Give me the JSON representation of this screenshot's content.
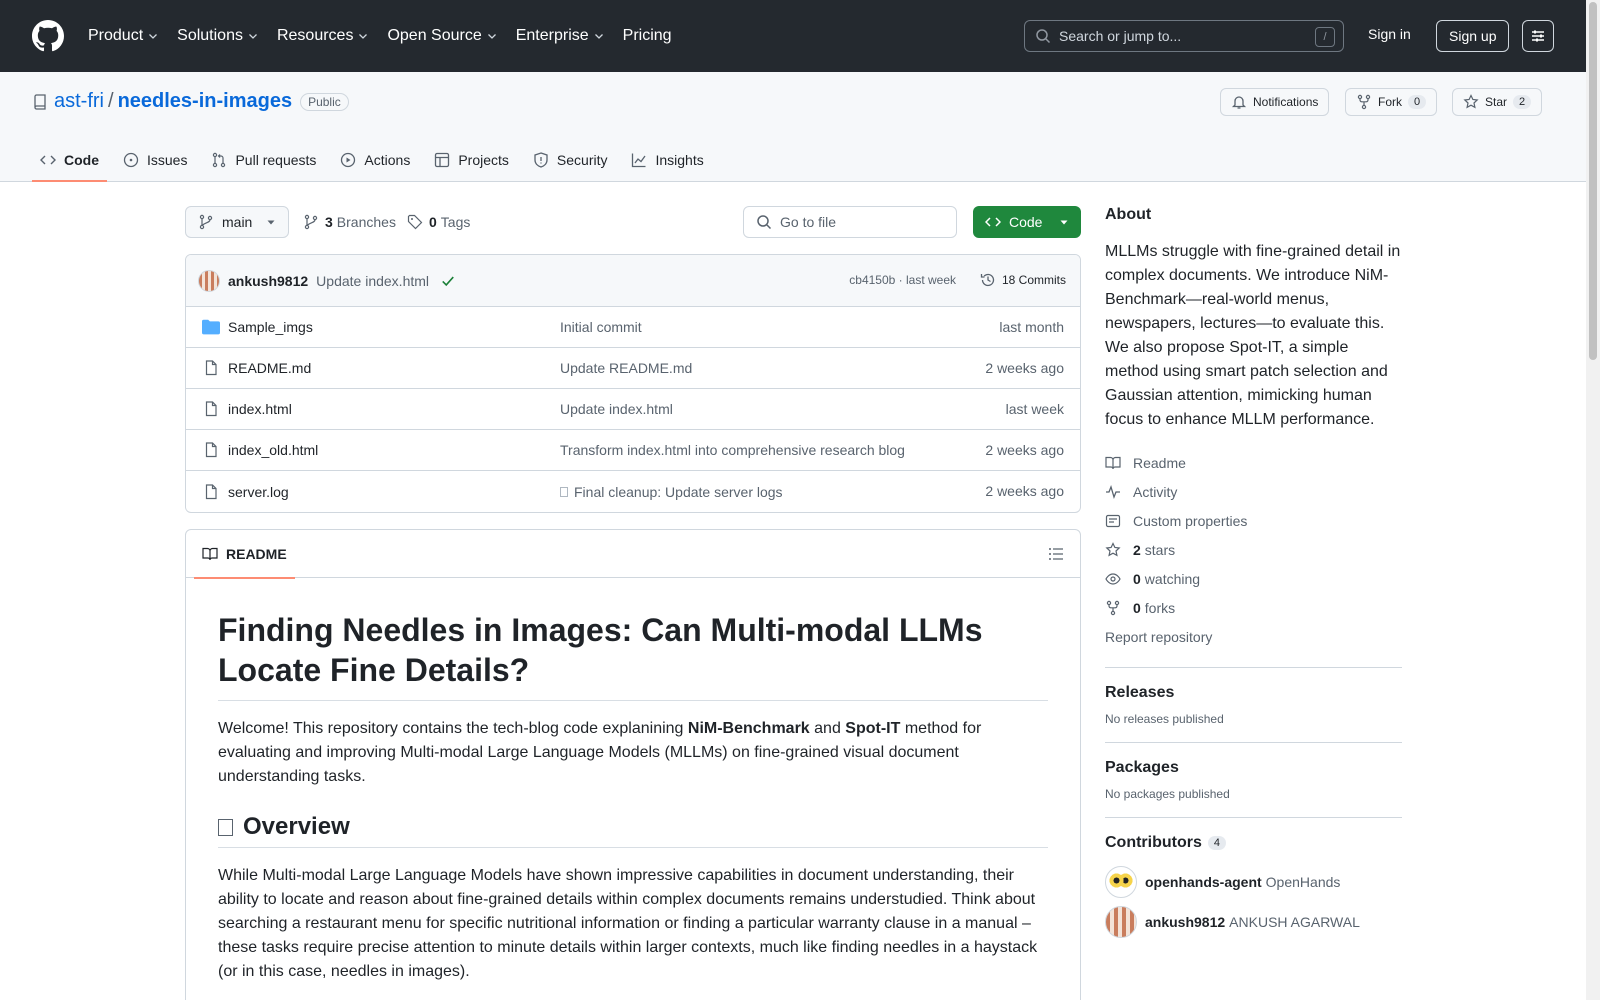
{
  "header": {
    "nav": [
      "Product",
      "Solutions",
      "Resources",
      "Open Source",
      "Enterprise",
      "Pricing"
    ],
    "search_placeholder": "Search or jump to...",
    "search_key": "/",
    "signin": "Sign in",
    "signup": "Sign up"
  },
  "repo": {
    "owner": "ast-fri",
    "sep": "/",
    "name": "needles-in-images",
    "visibility": "Public",
    "notifications": "Notifications",
    "fork_label": "Fork",
    "fork_count": "0",
    "star_label": "Star",
    "star_count": "2",
    "tabs": [
      "Code",
      "Issues",
      "Pull requests",
      "Actions",
      "Projects",
      "Security",
      "Insights"
    ]
  },
  "toolbar": {
    "branch": "main",
    "branches_count": "3",
    "branches_label": "Branches",
    "tags_count": "0",
    "tags_label": "Tags",
    "goto_placeholder": "Go to file",
    "code_label": "Code"
  },
  "commit": {
    "user": "ankush9812",
    "message": "Update index.html",
    "hash_time": "cb4150b · last week",
    "commits": "18 Commits"
  },
  "files": [
    {
      "name": "Sample_imgs",
      "type": "folder",
      "msg": "Initial commit",
      "time": "last month"
    },
    {
      "name": "README.md",
      "type": "file",
      "msg": "Update README.md",
      "time": "2 weeks ago"
    },
    {
      "name": "index.html",
      "type": "file",
      "msg": "Update index.html",
      "time": "last week"
    },
    {
      "name": "index_old.html",
      "type": "file",
      "msg": "Transform index.html into comprehensive research blog",
      "time": "2 weeks ago"
    },
    {
      "name": "server.log",
      "type": "file",
      "msg": "Final cleanup: Update server logs",
      "time": "2 weeks ago"
    }
  ],
  "readme": {
    "tab": "README",
    "title": "Finding Needles in Images: Can Multi-modal LLMs Locate Fine Details?",
    "intro_a": "Welcome! This repository contains the tech-blog code explanining ",
    "intro_b1": "NiM-Benchmark",
    "intro_c": " and ",
    "intro_b2": "Spot-IT",
    "intro_d": " method for evaluating and improving Multi-modal Large Language Models (MLLMs) on fine-grained visual document understanding tasks.",
    "overview_heading": "Overview",
    "overview_text": "While Multi-modal Large Language Models have shown impressive capabilities in document understanding, their ability to locate and reason about fine-grained details within complex documents remains understudied. Think about searching a restaurant menu for specific nutritional information or finding a particular warranty clause in a manual – these tasks require precise attention to minute details within larger contexts, much like finding needles in a haystack (or in this case, needles in images)."
  },
  "sidebar": {
    "about_title": "About",
    "about_text": "MLLMs struggle with fine-grained detail in complex documents. We introduce NiM-Benchmark—real-world menus, newspapers, lectures—to evaluate this. We also propose Spot-IT, a simple method using smart patch selection and Gaussian attention, mimicking human focus to enhance MLLM performance.",
    "readme": "Readme",
    "activity": "Activity",
    "custom_props": "Custom properties",
    "stars_count": "2",
    "stars_label": "stars",
    "watching_count": "0",
    "watching_label": "watching",
    "forks_count": "0",
    "forks_label": "forks",
    "report": "Report repository",
    "releases_title": "Releases",
    "releases_text": "No releases published",
    "packages_title": "Packages",
    "packages_text": "No packages published",
    "contributors_title": "Contributors",
    "contributors_count": "4",
    "contributors": [
      {
        "login": "openhands-agent",
        "name": "OpenHands"
      },
      {
        "login": "ankush9812",
        "name": "ANKUSH AGARWAL"
      }
    ]
  },
  "colors": {
    "accent": "#0969da",
    "green": "#1f883d",
    "header": "#24292f",
    "tab_underline": "#fd8c73"
  }
}
